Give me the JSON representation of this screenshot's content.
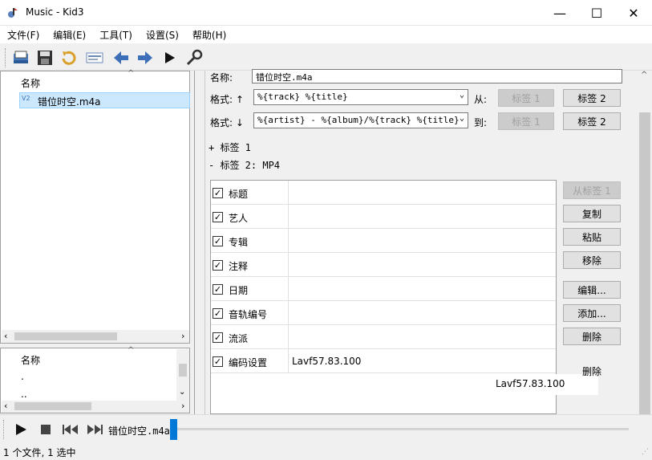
{
  "window": {
    "title": "Music - Kid3",
    "minimize": "—",
    "maximize": "☐",
    "close": "✕"
  },
  "menu": [
    "文件(F)",
    "编辑(E)",
    "工具(T)",
    "设置(S)",
    "帮助(H)"
  ],
  "toolbar_icons": [
    "open-icon",
    "save-icon",
    "revert-icon",
    "tags-icon",
    "previous-icon",
    "next-icon",
    "play-icon",
    "settings-icon"
  ],
  "file_list": {
    "header": "名称",
    "items": [
      "错位时空.m4a"
    ]
  },
  "dir_list": {
    "header": "名称",
    "items": [
      ".",
      ".."
    ]
  },
  "tag_panel": {
    "name_label": "名称:",
    "name_value": "错位时空.m4a",
    "format_up_label": "格式: ↑",
    "format_up_value": "%{track} %{title}",
    "from_label": "从:",
    "format_down_label": "格式: ↓",
    "format_down_value": "%{artist} - %{album}/%{track} %{title}",
    "to_label": "到:",
    "tag1_btn": "标签 1",
    "tag2_btn": "标签 2",
    "tag1_section": "+ 标签 1",
    "tag2_section": "- 标签 2: MP4"
  },
  "frames": [
    {
      "name": "标题",
      "value": ""
    },
    {
      "name": "艺人",
      "value": ""
    },
    {
      "name": "专辑",
      "value": ""
    },
    {
      "name": "注释",
      "value": ""
    },
    {
      "name": "日期",
      "value": ""
    },
    {
      "name": "音轨编号",
      "value": ""
    },
    {
      "name": "流派",
      "value": ""
    },
    {
      "name": "编码设置",
      "value": "Lavf57.83.100"
    }
  ],
  "tooltip": "Lavf57.83.100",
  "frame_buttons": {
    "from_tag1": "从标签 1",
    "copy": "复制",
    "paste": "粘贴",
    "remove": "移除",
    "edit": "编辑...",
    "add": "添加...",
    "delete": "删除",
    "delete_dup": "删除"
  },
  "player": {
    "track": "错位时空.m4a",
    "progress": 0
  },
  "status": "1 个文件, 1 选中"
}
